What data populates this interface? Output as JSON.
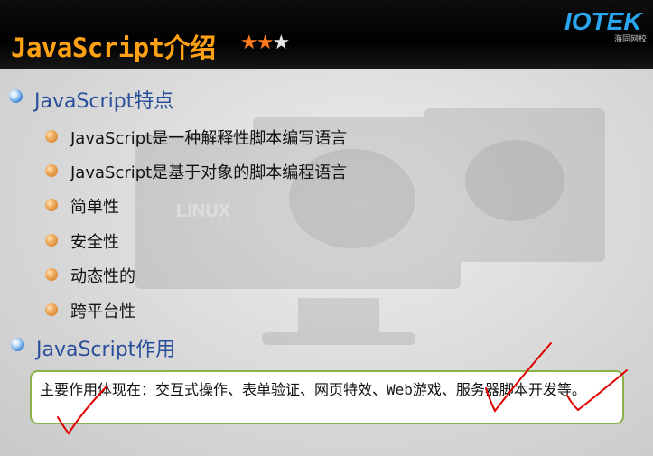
{
  "header": {
    "title": "JavaScript介绍",
    "stars_filled": 2,
    "stars_total": 3,
    "logo_text": "IOTEK",
    "logo_sub": "海同网校"
  },
  "section1": {
    "heading": "JavaScript特点",
    "items": [
      "JavaScript是一种解释性脚本编写语言",
      "JavaScript是基于对象的脚本编程语言",
      "简单性",
      "安全性",
      "动态性的",
      "跨平台性"
    ]
  },
  "section2": {
    "heading": "JavaScript作用",
    "box_text": "主要作用体现在：交互式操作、表单验证、网页特效、Web游戏、服务器脚本开发等。"
  },
  "colors": {
    "title": "#ffa114",
    "heading": "#2a4f9a",
    "box_border": "#8ab24a",
    "ink_marks": "#e00000"
  }
}
